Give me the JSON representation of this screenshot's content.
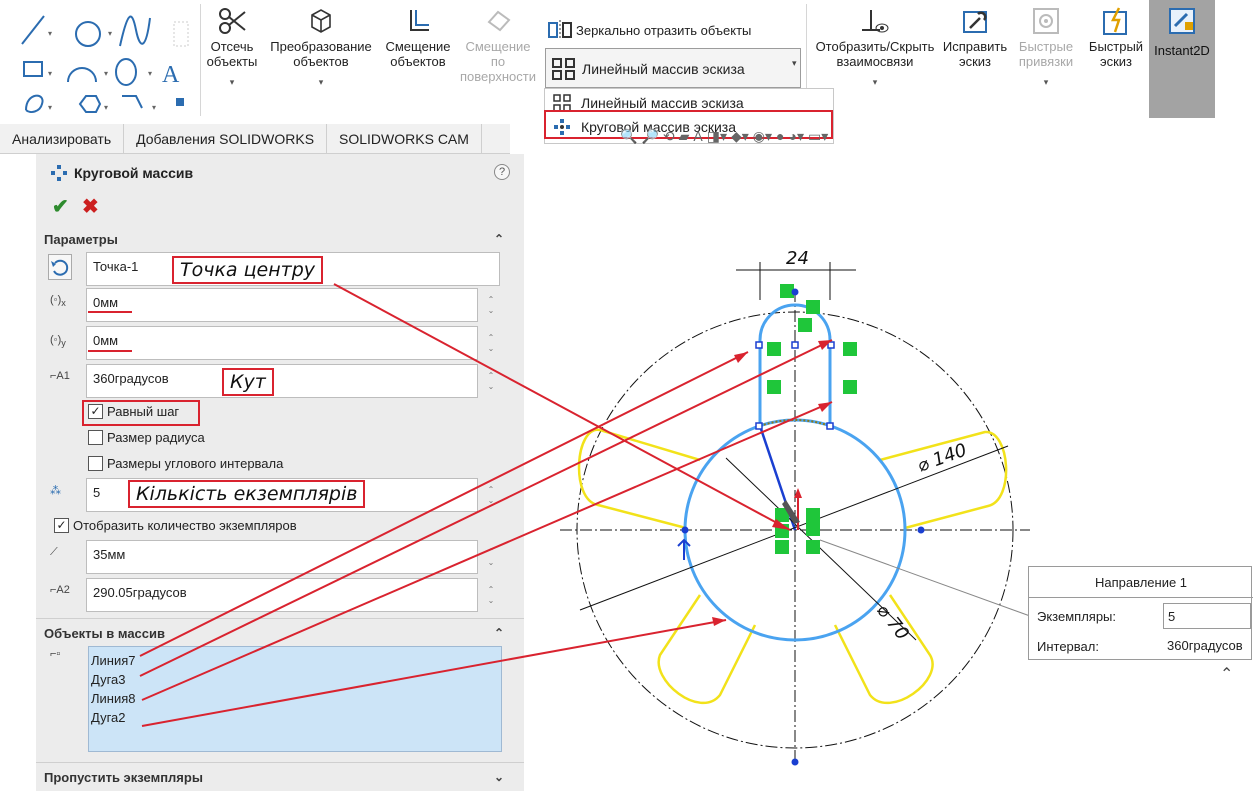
{
  "ribbon": {
    "trim_label_1": "Отсечь",
    "trim_label_2": "объекты",
    "convert_label_1": "Преобразование",
    "convert_label_2": "объектов",
    "offset_label_1": "Смещение",
    "offset_label_2": "объектов",
    "offset_surface_label_1": "Смещение",
    "offset_surface_label_2": "по",
    "offset_surface_label_3": "поверхности",
    "mirror_label": "Зеркально отразить объекты",
    "linear_pattern_label": "Линейный массив эскиза",
    "relations_label_1": "Отобразить/Скрыть",
    "relations_label_2": "взаимосвязи",
    "repair_label_1": "Исправить",
    "repair_label_2": "эскиз",
    "quick_snaps_label_1": "Быстрые",
    "quick_snaps_label_2": "привязки",
    "rapid_sketch_label_1": "Быстрый",
    "rapid_sketch_label_2": "эскиз",
    "instant2d_label": "Instant2D"
  },
  "dropdown": {
    "items": [
      {
        "label": "Линейный массив эскиза"
      },
      {
        "label": "Круговой массив эскиза"
      }
    ]
  },
  "tabs": [
    "Анализировать",
    "Добавления SOLIDWORKS",
    "SOLIDWORKS CAM"
  ],
  "pm": {
    "title": "Круговой массив",
    "params_header": "Параметры",
    "center_point": "Точка-1",
    "x_value": "0мм",
    "y_value": "0мм",
    "angle_value": "360градусов",
    "equal_spacing": "Равный шаг",
    "equal_spacing_checked": true,
    "radius_dim": "Размер радиуса",
    "angular_dims": "Размеры углового интервала",
    "instances": "5",
    "show_instances": "Отобразить количество экземпляров",
    "radius_value": "35мм",
    "arc_angle_value": "290.05градусов",
    "entities_header": "Объекты в массив",
    "entities": [
      "Линия7",
      "Дуга3",
      "Линия8",
      "Дуга2"
    ],
    "skip_header": "Пропустить экземпляры"
  },
  "annotations": {
    "center_point": "Точка центру",
    "angle": "Кут",
    "count": "Кількість екземплярів"
  },
  "drawing": {
    "dim_24": "24",
    "dim_140": "⌀ 140",
    "dim_70": "⌀ 70"
  },
  "callout": {
    "header": "Направление 1",
    "instances_label": "Экземпляры:",
    "instances_value": "5",
    "spacing_label": "Интервал:",
    "spacing_value": "360градусов"
  },
  "colors": {
    "accent_red": "#d9232f",
    "sketch_blue": "#4aa3f0",
    "pattern_yellow": "#f2e21a",
    "relation_green": "#1fc63a"
  }
}
